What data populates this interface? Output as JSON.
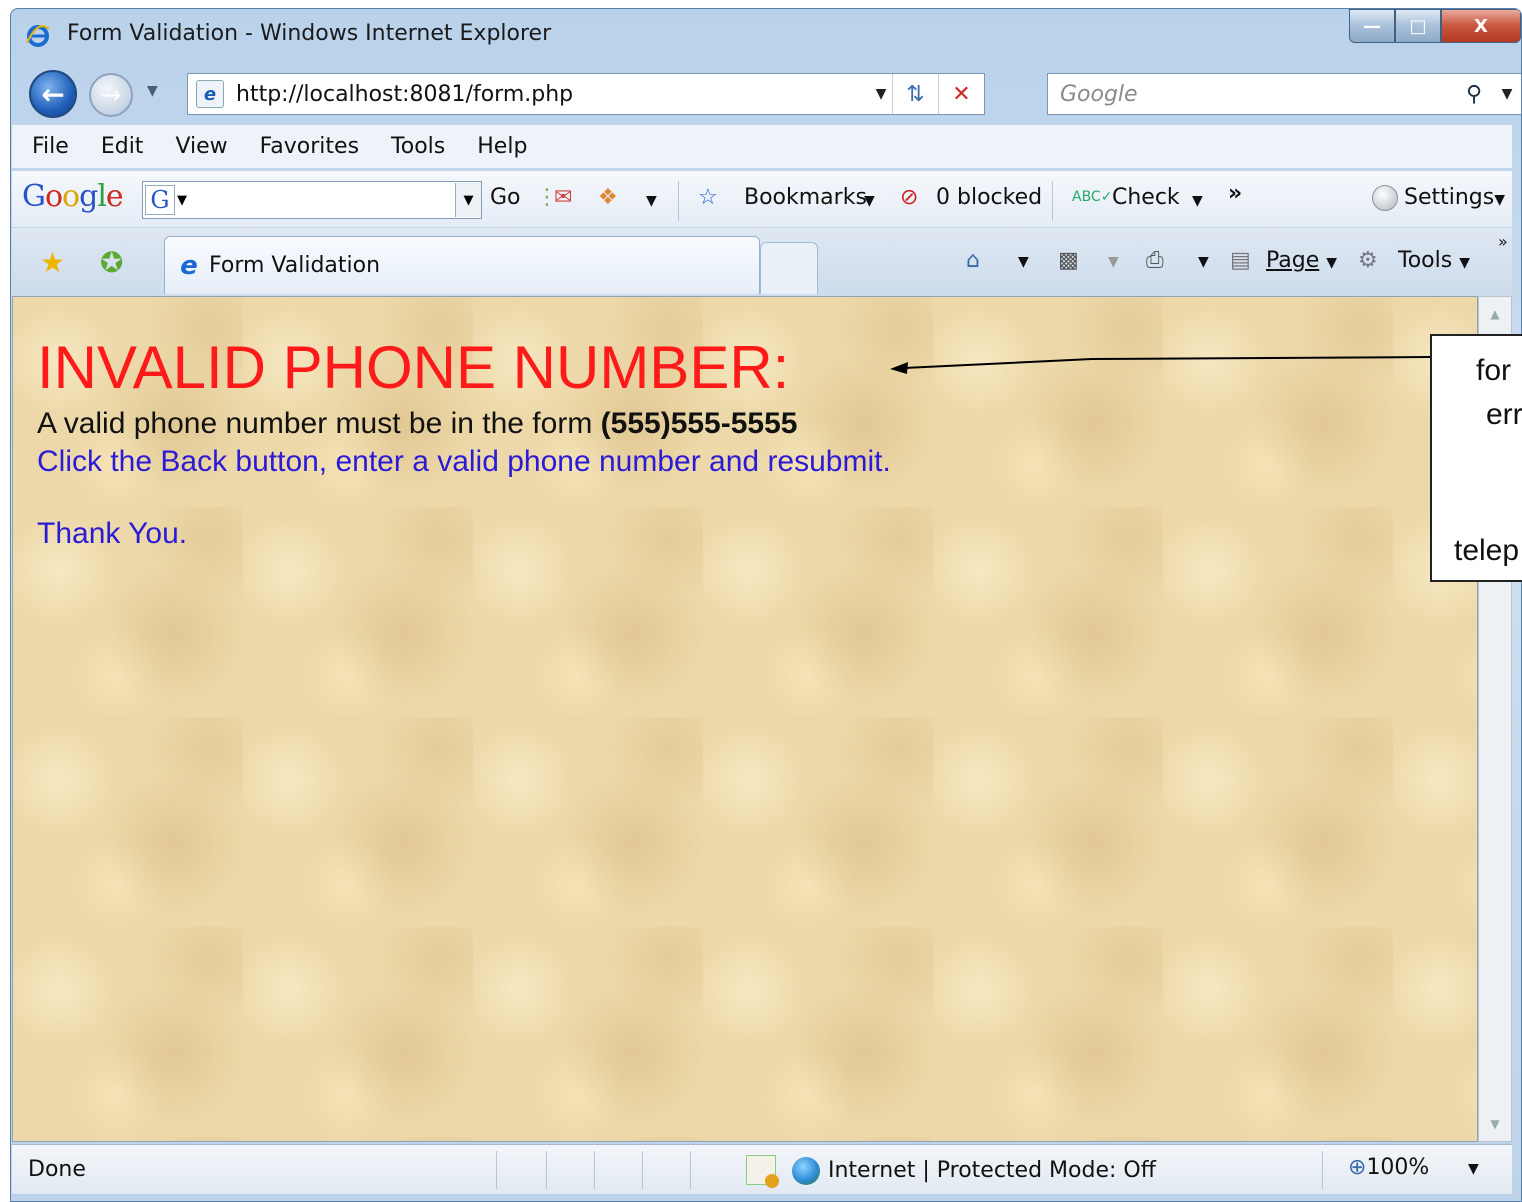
{
  "window": {
    "title": "Form Validation - Windows Internet Explorer",
    "controls": {
      "minimize": "—",
      "maximize": "□",
      "close": "X"
    }
  },
  "address_bar": {
    "url": "http://localhost:8081/form.php",
    "search_placeholder": "Google"
  },
  "menu": {
    "items": [
      "File",
      "Edit",
      "View",
      "Favorites",
      "Tools",
      "Help"
    ]
  },
  "google_toolbar": {
    "go_label": "Go",
    "bookmarks_label": "Bookmarks",
    "blocked_label": "0 blocked",
    "check_label": "Check",
    "more_label": "»",
    "settings_label": "Settings"
  },
  "tabs": {
    "active_tab_label": "Form Validation"
  },
  "command_bar": {
    "page_label": "Page",
    "tools_label": "Tools",
    "more_label": "»"
  },
  "page": {
    "error_heading": "INVALID PHONE NUMBER:",
    "rule_text": "A valid phone number must be in the form ",
    "rule_format": "(555)555-5555",
    "instruction": "Click the Back button, enter a valid phone number and resubmit.",
    "thanks": "Thank You."
  },
  "callout": {
    "line1": "for",
    "line2": "err",
    "line3": "telep"
  },
  "status_bar": {
    "status": "Done",
    "zone": "Internet | Protected Mode: Off",
    "zoom": "100%"
  },
  "colors": {
    "error_red": "#ff1a1a",
    "link_blue": "#2b1bd6",
    "parchment": "#ecd8a8"
  }
}
